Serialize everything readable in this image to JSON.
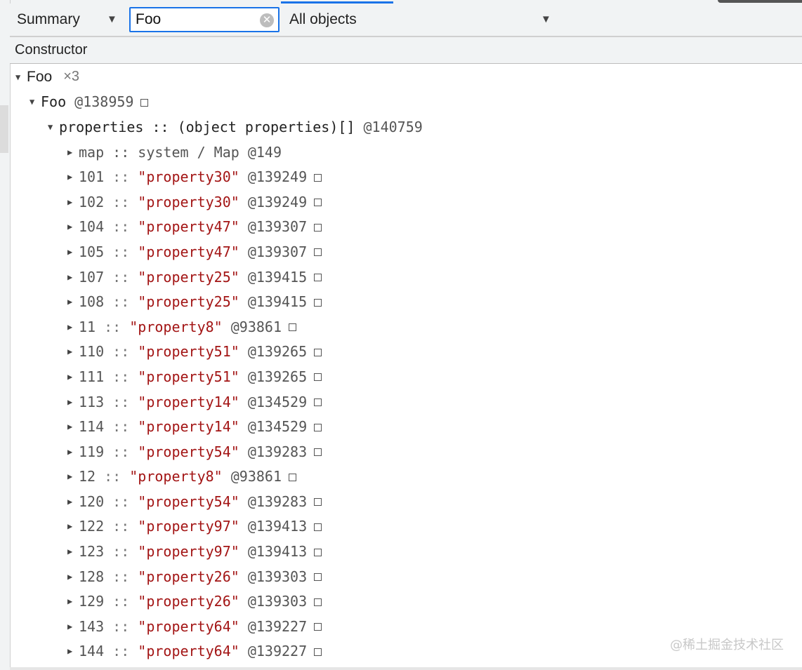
{
  "toolbar": {
    "view_select": "Summary",
    "filter_value": "Foo",
    "object_select": "All objects"
  },
  "grid": {
    "column_header": "Constructor"
  },
  "tree": {
    "group": {
      "name": "Foo",
      "count": "×3"
    },
    "instance": {
      "name": "Foo",
      "id": "@138959"
    },
    "properties_node": {
      "label": "properties :: (object properties)[]",
      "id": "@140759"
    },
    "map_node": {
      "label": "map :: system / Map",
      "id": "@149"
    },
    "children": [
      {
        "key": "101",
        "value": "\"property30\"",
        "id": "@139249"
      },
      {
        "key": "102",
        "value": "\"property30\"",
        "id": "@139249"
      },
      {
        "key": "104",
        "value": "\"property47\"",
        "id": "@139307"
      },
      {
        "key": "105",
        "value": "\"property47\"",
        "id": "@139307"
      },
      {
        "key": "107",
        "value": "\"property25\"",
        "id": "@139415"
      },
      {
        "key": "108",
        "value": "\"property25\"",
        "id": "@139415"
      },
      {
        "key": "11",
        "value": "\"property8\"",
        "id": "@93861"
      },
      {
        "key": "110",
        "value": "\"property51\"",
        "id": "@139265"
      },
      {
        "key": "111",
        "value": "\"property51\"",
        "id": "@139265"
      },
      {
        "key": "113",
        "value": "\"property14\"",
        "id": "@134529"
      },
      {
        "key": "114",
        "value": "\"property14\"",
        "id": "@134529"
      },
      {
        "key": "119",
        "value": "\"property54\"",
        "id": "@139283"
      },
      {
        "key": "12",
        "value": "\"property8\"",
        "id": "@93861"
      },
      {
        "key": "120",
        "value": "\"property54\"",
        "id": "@139283"
      },
      {
        "key": "122",
        "value": "\"property97\"",
        "id": "@139413"
      },
      {
        "key": "123",
        "value": "\"property97\"",
        "id": "@139413"
      },
      {
        "key": "128",
        "value": "\"property26\"",
        "id": "@139303"
      },
      {
        "key": "129",
        "value": "\"property26\"",
        "id": "@139303"
      },
      {
        "key": "143",
        "value": "\"property64\"",
        "id": "@139227"
      },
      {
        "key": "144",
        "value": "\"property64\"",
        "id": "@139227"
      }
    ]
  },
  "watermark": "@稀土掘金技术社区",
  "icons": {
    "expanded": "triangle-down-icon",
    "collapsed": "triangle-right-icon",
    "reveal": "square-icon",
    "clear": "clear-icon",
    "dropdown": "caret-down-icon"
  },
  "colors": {
    "accent": "#1a73e8",
    "string_value": "#a31515",
    "toolbar_bg": "#f1f3f4"
  }
}
